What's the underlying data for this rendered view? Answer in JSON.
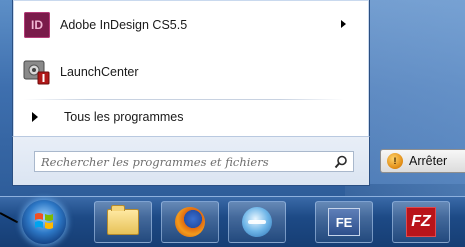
{
  "start_menu": {
    "pinned_items": [
      {
        "label": "Adobe InDesign CS5.5",
        "icon": "indesign-icon",
        "icon_text": "ID",
        "has_submenu": true
      },
      {
        "label": "LaunchCenter",
        "icon": "launchcenter-icon",
        "has_submenu": false
      }
    ],
    "all_programs_label": "Tous les programmes",
    "search_placeholder": "Rechercher les programmes et fichiers",
    "shutdown_label": "Arrêter"
  },
  "taskbar": {
    "items": [
      {
        "name": "start-orb",
        "icon": "windows-logo-icon"
      },
      {
        "name": "explorer",
        "icon": "folder-icon"
      },
      {
        "name": "firefox",
        "icon": "firefox-icon"
      },
      {
        "name": "browser",
        "icon": "globe-icon"
      },
      {
        "name": "fe",
        "icon": "fe-icon",
        "text": "FE"
      },
      {
        "name": "filezilla",
        "icon": "filezilla-icon",
        "text": "FZ"
      }
    ]
  },
  "colors": {
    "accent": "#3e6fae",
    "taskbar": "#1d4a86",
    "indesign": "#7a1b4a",
    "filezilla": "#b9141a"
  }
}
